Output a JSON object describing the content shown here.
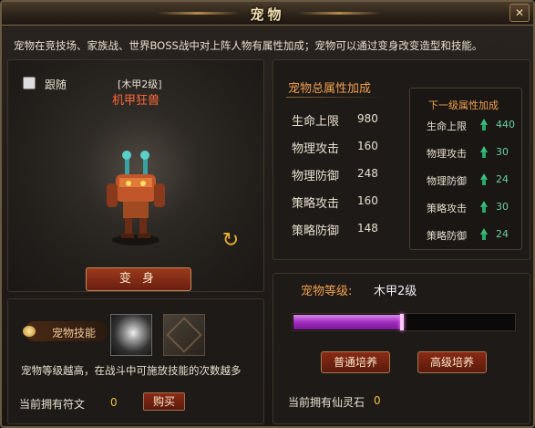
{
  "window": {
    "title": "宠物",
    "close_label": "✕"
  },
  "description": "宠物在竞技场、家族战、世界BOSS战中对上阵人物有属性加成；宠物可以通过变身改变造型和技能。",
  "pet": {
    "follow_label": "跟随",
    "follow_checked": false,
    "rank": "[木甲2级]",
    "name": "机甲狂兽",
    "rotate_icon": "rotate-arrows",
    "transform_button": "变 身"
  },
  "skills": {
    "label": "宠物技能",
    "slots": [
      {
        "icon": "whirlwind-skill"
      },
      {
        "icon": "rune-locked-skill"
      }
    ],
    "note": "宠物等级越高，在战斗中可施放技能的次数越多",
    "rune_label": "当前拥有符文",
    "rune_count": "0",
    "buy_button": "购买"
  },
  "attributes": {
    "title": "宠物总属性加成",
    "rows": [
      {
        "label": "生命上限",
        "value": "980"
      },
      {
        "label": "物理攻击",
        "value": "160"
      },
      {
        "label": "物理防御",
        "value": "248"
      },
      {
        "label": "策略攻击",
        "value": "160"
      },
      {
        "label": "策略防御",
        "value": "148"
      }
    ],
    "next_level": {
      "title": "下一级属性加成",
      "rows": [
        {
          "label": "生命上限",
          "value": "440"
        },
        {
          "label": "物理攻击",
          "value": "30"
        },
        {
          "label": "物理防御",
          "value": "24"
        },
        {
          "label": "策略攻击",
          "value": "30"
        },
        {
          "label": "策略防御",
          "value": "24"
        }
      ]
    }
  },
  "level": {
    "label": "宠物等级:",
    "value": "木甲2级",
    "progress": 0.49,
    "normal_train_button": "普通培养",
    "advanced_train_button": "高级培养",
    "crystal_label": "当前拥有仙灵石",
    "crystal_count": "0"
  },
  "colors": {
    "accent": "#f0a050",
    "positive": "#3ac07a",
    "progress": "#a02cc0",
    "button": "#8a2a14"
  }
}
